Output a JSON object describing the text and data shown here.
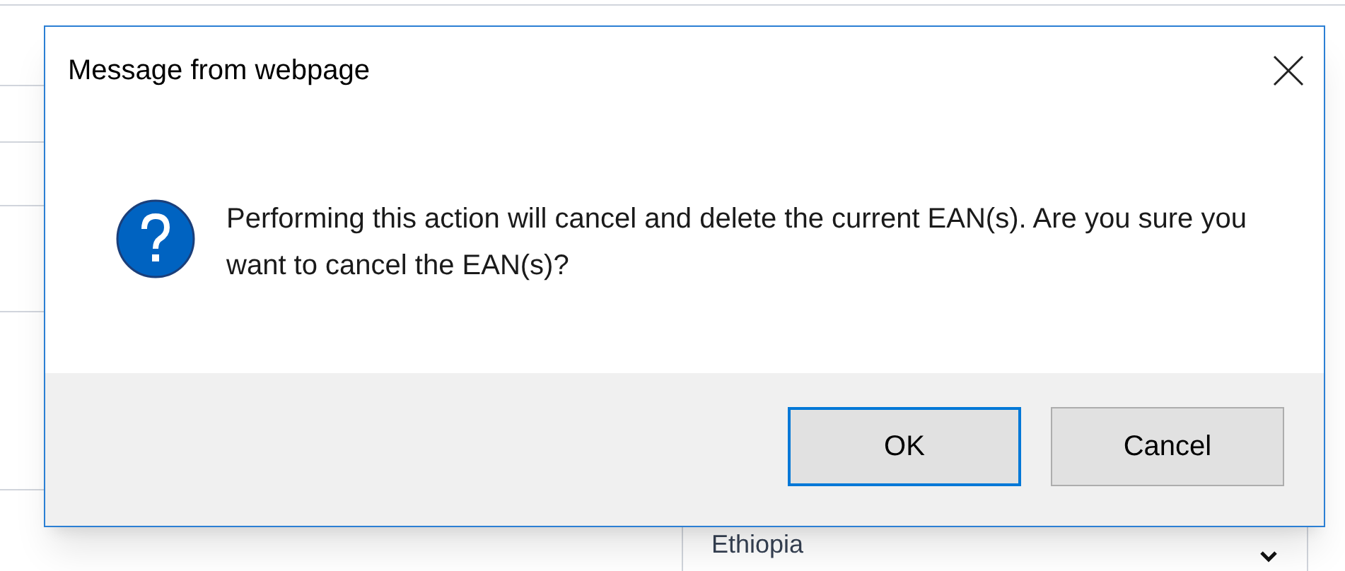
{
  "background": {
    "country_select": {
      "value": "Ethiopia"
    }
  },
  "dialog": {
    "title": "Message from webpage",
    "message": "Performing this action will cancel and delete the current EAN(s). Are you sure you want to cancel the EAN(s)?",
    "buttons": [
      {
        "label": "OK",
        "selected": true
      },
      {
        "label": "Cancel",
        "selected": false
      }
    ]
  }
}
